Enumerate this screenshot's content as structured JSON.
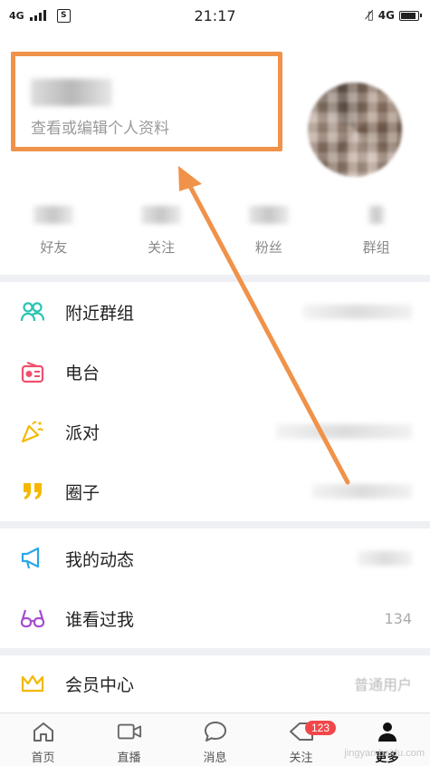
{
  "status_bar": {
    "network_left": "4G",
    "sim_badge": "S",
    "time": "21:17",
    "vibrate_icon": "vibrate-icon",
    "network_right": "4G",
    "battery_level": 0.8
  },
  "profile": {
    "name_visible": "",
    "subtitle": "查看或编辑个人资料"
  },
  "stats": [
    {
      "label": "好友"
    },
    {
      "label": "关注"
    },
    {
      "label": "粉丝"
    },
    {
      "label": "群组"
    }
  ],
  "menu_groups": [
    [
      {
        "label": "附近群组",
        "icon": "people-icon",
        "color": "#2bc4b4"
      },
      {
        "label": "电台",
        "icon": "radio-icon",
        "color": "#f0506e"
      },
      {
        "label": "派对",
        "icon": "party-icon",
        "color": "#f5b800"
      },
      {
        "label": "圈子",
        "icon": "quote-icon",
        "color": "#f5b800"
      }
    ],
    [
      {
        "label": "我的动态",
        "icon": "megaphone-icon",
        "color": "#2aa7e8"
      },
      {
        "label": "谁看过我",
        "icon": "glasses-icon",
        "color": "#a44ccf",
        "right": "134"
      }
    ],
    [
      {
        "label": "会员中心",
        "icon": "crown-icon",
        "color": "#f5b800",
        "right": "普通用户"
      }
    ]
  ],
  "bottom_nav": [
    {
      "label": "首页",
      "icon": "home-icon"
    },
    {
      "label": "直播",
      "icon": "video-icon"
    },
    {
      "label": "消息",
      "icon": "chat-icon"
    },
    {
      "label": "关注",
      "icon": "heart-icon",
      "badge": "123"
    },
    {
      "label": "更多",
      "icon": "user-icon",
      "active": true
    }
  ],
  "watermark": "jingyan.baidu.com",
  "colors": {
    "highlight": "#f0924a",
    "badge": "#f2474a",
    "section_gap": "#eef0f3"
  }
}
